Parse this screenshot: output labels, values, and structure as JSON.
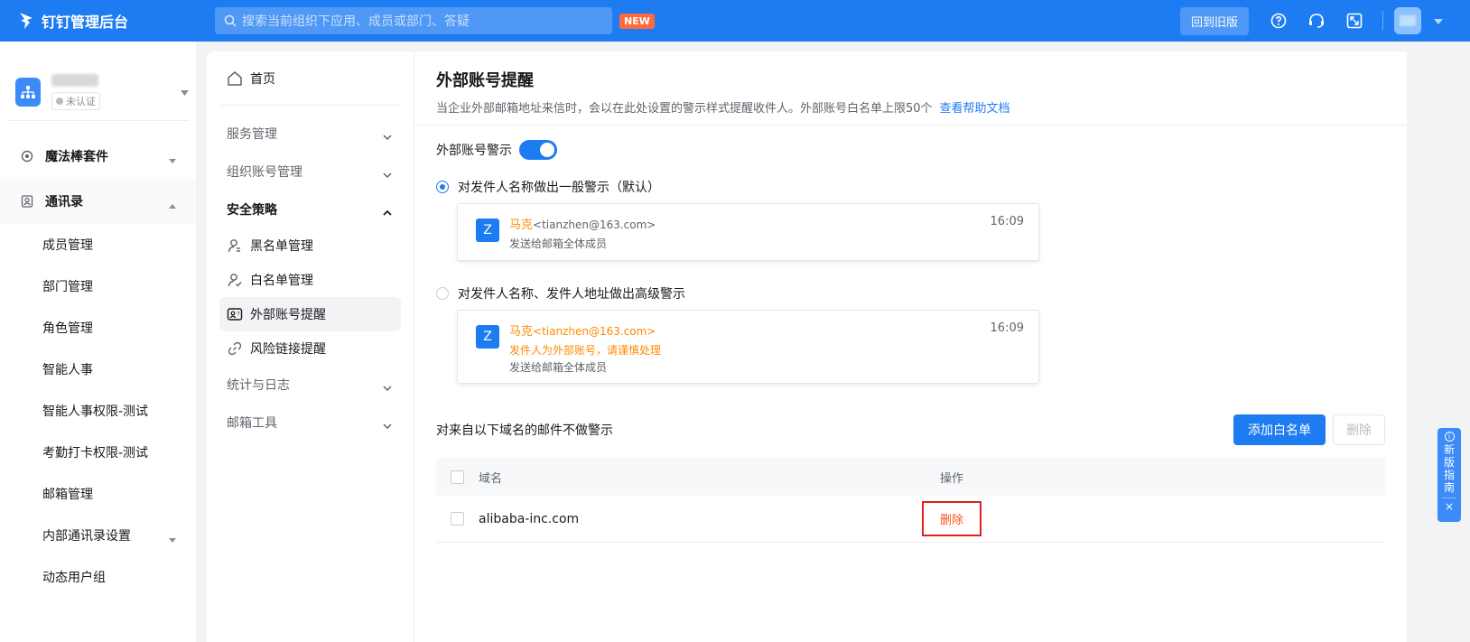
{
  "topbar": {
    "app_title": "钉钉管理后台",
    "search_placeholder": "搜索当前组织下应用、成员或部门、答疑",
    "new_badge": "NEW",
    "back_old_label": "回到旧版"
  },
  "org": {
    "tag": "未认证"
  },
  "sidebar": {
    "groups": [
      {
        "label": "魔法棒套件",
        "icon": "magic-wand-icon"
      },
      {
        "label": "通讯录",
        "icon": "contacts-icon"
      }
    ],
    "items": [
      {
        "label": "成员管理"
      },
      {
        "label": "部门管理"
      },
      {
        "label": "角色管理"
      },
      {
        "label": "智能人事"
      },
      {
        "label": "智能人事权限-测试"
      },
      {
        "label": "考勤打卡权限-测试"
      },
      {
        "label": "邮箱管理"
      },
      {
        "label": "内部通讯录设置"
      },
      {
        "label": "动态用户组"
      }
    ]
  },
  "midmenu": {
    "home": "首页",
    "sections": [
      {
        "label": "服务管理"
      },
      {
        "label": "组织账号管理"
      },
      {
        "label": "安全策略"
      },
      {
        "label": "统计与日志"
      },
      {
        "label": "邮箱工具"
      }
    ],
    "security_items": [
      {
        "label": "黑名单管理",
        "icon": "blacklist-icon"
      },
      {
        "label": "白名单管理",
        "icon": "whitelist-icon"
      },
      {
        "label": "外部账号提醒",
        "icon": "external-account-icon"
      },
      {
        "label": "风险链接提醒",
        "icon": "link-icon"
      }
    ]
  },
  "content": {
    "title": "外部账号提醒",
    "description": "当企业外部邮箱地址来信时，会以在此处设置的警示样式提醒收件人。外部账号白名单上限50个",
    "help_link": "查看帮助文档",
    "toggle_label": "外部账号警示",
    "toggle_on": true,
    "option1": {
      "label": "对发件人名称做出一般警示（默认）",
      "selected": true,
      "card": {
        "avatar_letter": "Z",
        "sender": "马克",
        "email": "<tianzhen@163.com>",
        "sub": "发送给邮箱全体成员",
        "time": "16:09"
      }
    },
    "option2": {
      "label": "对发件人名称、发件人地址做出高级警示",
      "selected": false,
      "card": {
        "avatar_letter": "Z",
        "sender": "马克",
        "email": "<tianzhen@163.com>",
        "warning": "发件人为外部账号，请谨慎处理",
        "sub": "发送给邮箱全体成员",
        "time": "16:09"
      }
    },
    "whitelist": {
      "title": "对来自以下域名的邮件不做警示",
      "add_button": "添加白名单",
      "delete_button": "删除",
      "columns": [
        "域名",
        "操作"
      ],
      "rows": [
        {
          "domain": "alibaba-inc.com",
          "action": "删除"
        }
      ]
    }
  },
  "guide": {
    "chars": [
      "新",
      "版",
      "指",
      "南"
    ],
    "close": "×"
  },
  "colors": {
    "primary": "#1e7cf2",
    "warning": "#ff8a00",
    "danger": "#ff5219"
  }
}
